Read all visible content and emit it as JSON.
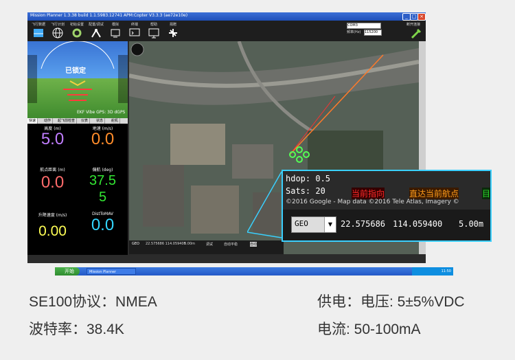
{
  "window": {
    "title": "Mission Planner 1.3.38 build 1.1.5983.12741 APM:Copter V3.3.3 (ae72e10e)"
  },
  "menu": [
    {
      "label": "飞行数据",
      "icon": "flight-data-icon"
    },
    {
      "label": "飞行计划",
      "icon": "globe-icon"
    },
    {
      "label": "初始设置",
      "icon": "setup-icon"
    },
    {
      "label": "配置/调试",
      "icon": "config-icon"
    },
    {
      "label": "模拟",
      "icon": "simulation-icon"
    },
    {
      "label": "终端",
      "icon": "terminal-icon"
    },
    {
      "label": "帮助",
      "icon": "help-icon"
    },
    {
      "label": "捐赠",
      "icon": "donate-icon"
    }
  ],
  "connection": {
    "port": "COM3",
    "baud_label": "频率(Hz)",
    "baud": "115200",
    "connect_label": "断开连接"
  },
  "hud": {
    "status": "已锁定",
    "bottom": "EKF Vibe GPS: 3D dGPS"
  },
  "tabs": [
    "快速",
    "动作",
    "起飞前检查",
    "仪表",
    "状态",
    "舵机"
  ],
  "quick": [
    {
      "label": "高度 (m)",
      "value": "5.0",
      "color": "#c07dff"
    },
    {
      "label": "地速 (m/s)",
      "value": "0.0",
      "color": "#ff8c2a"
    },
    {
      "label": "航点距离 (m)",
      "value": "0.0",
      "color": "#ff6b6b"
    },
    {
      "label": "偏航 (deg)",
      "value": "37.5",
      "color": "#33e633"
    },
    {
      "label": "升降速度 (m/s)",
      "value": "0.00",
      "color": "#ffff55"
    },
    {
      "label": "DistToMAV",
      "value": "0.0",
      "color": "#33d6ff"
    }
  ],
  "quick_value_wrap": "5",
  "strip": {
    "geo": "GEO",
    "coords": "22.575686 114.059400",
    "alt": "5.00m",
    "btn1": "调试",
    "btn2": "自动平稳",
    "sel": "自动"
  },
  "taskbar": {
    "start": "开始",
    "app": "Mission Planner",
    "time": "11:50"
  },
  "zoom": {
    "hdop": "hdop: 0.5",
    "sats": "Sats: 20",
    "legend_current": "当前指向",
    "legend_direct": "直达当前航点",
    "legend_wp": "目",
    "copyright": "©2016 Google - Map data ©2016 Tele Atlas, Imagery ©",
    "geo": "GEO",
    "lat": "22.575686",
    "lng": "114.059400",
    "alt": "5.00m"
  },
  "specs": {
    "protocol": "SE100协议：NMEA",
    "baud": "波特率：38.4K",
    "power": "供电：电压: 5±5%VDC",
    "current": "电流: 50-100mA"
  }
}
